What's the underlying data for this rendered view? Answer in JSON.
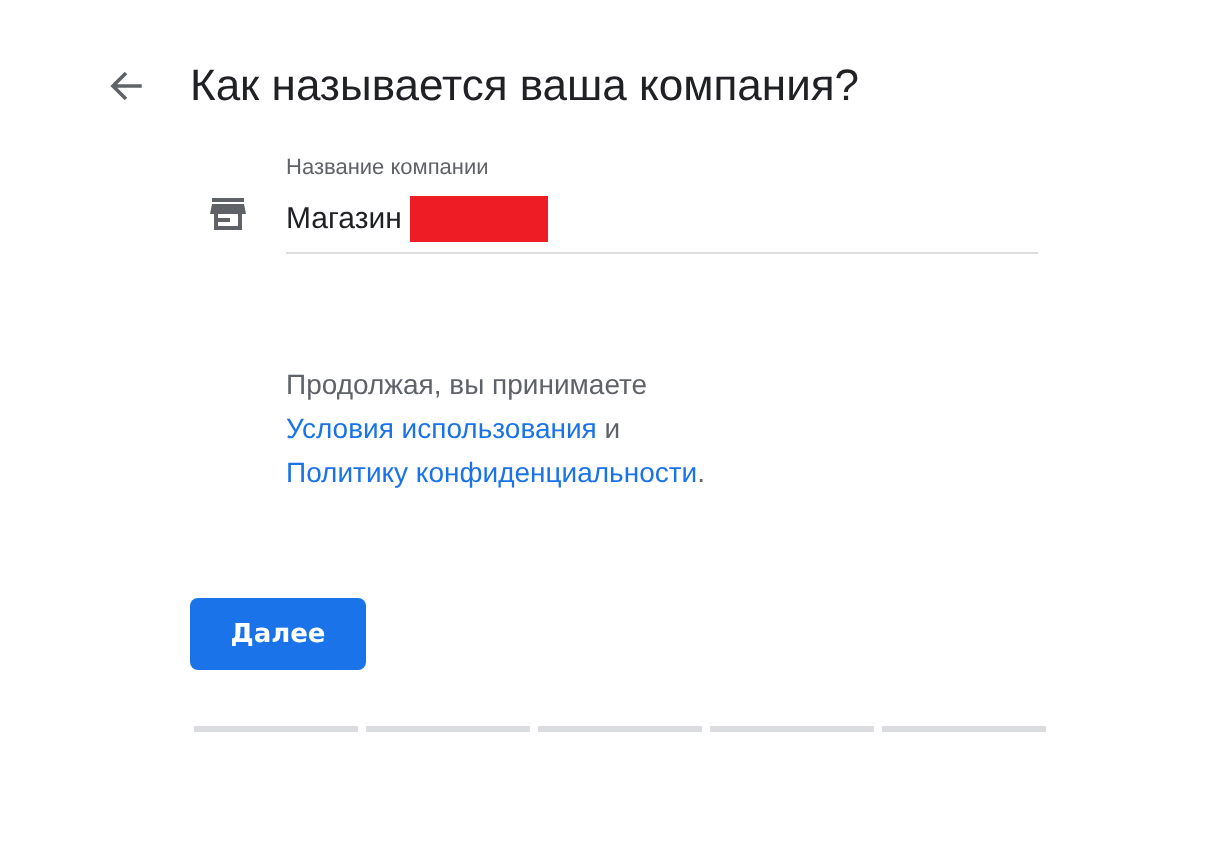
{
  "title": "Как называется ваша компания?",
  "field": {
    "label": "Название компании",
    "value": "Магазин"
  },
  "consent": {
    "before": "Продолжая, вы принимаете ",
    "link1": "Условия использования",
    "middle": " и ",
    "link2": "Политику конфиденциальности",
    "after": "."
  },
  "button": "Далее",
  "steps": [
    {
      "done": false
    },
    {
      "done": false
    },
    {
      "done": false
    },
    {
      "done": false
    },
    {
      "done": false
    }
  ]
}
